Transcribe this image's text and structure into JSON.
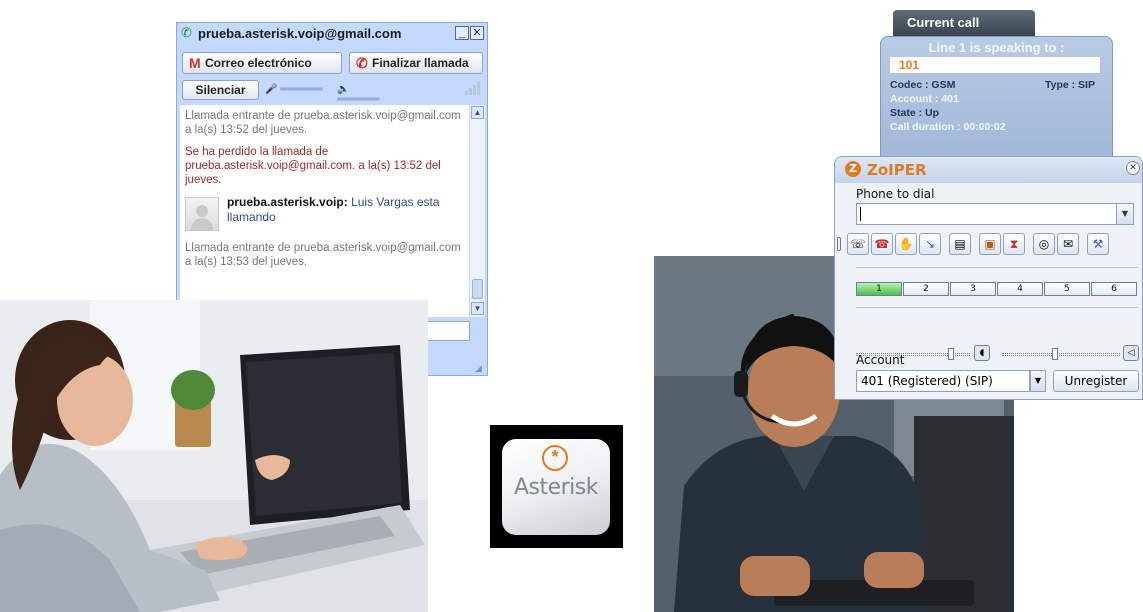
{
  "gmail_chat": {
    "title": "prueba.asterisk.voip@gmail.com",
    "minimize_glyph": "_",
    "close_glyph": "✕",
    "email_button": "Correo electrónico",
    "hangup_button": "Finalizar llamada",
    "mute_button": "Silenciar",
    "messages": [
      {
        "text": "Llamada entrante de prueba.asterisk.voip@gmail.com a la(s) 13:52 del jueves."
      },
      {
        "text": "Se ha perdido la llamada de prueba.asterisk.voip@gmail.com. a la(s) 13:52 del jueves."
      },
      {
        "text": "Llamada entrante de prueba.asterisk.voip@gmail.com a la(s) 13:53 del jueves."
      }
    ],
    "caller": {
      "name": "prueba.asterisk.voip:",
      "text": "Luis Vargas esta llamando"
    },
    "icons": {
      "phone": "phone-icon",
      "gmail": "gmail-icon",
      "mic": "microphone-icon",
      "speaker": "speaker-icon",
      "signal": "signal-icon"
    }
  },
  "asterisk_logo": {
    "word": "Asterisk",
    "mark": "*"
  },
  "current_call": {
    "tab": "Current call",
    "heading": "Line 1 is speaking to :",
    "number": "101",
    "codec": "Codec : GSM",
    "type": "Type : SIP",
    "account": "Account : 401",
    "state": "State : Up",
    "duration": "Call duration : 00:00:02"
  },
  "zoiper": {
    "brand": "ZoIPER",
    "phone_label": "Phone to dial",
    "dial_value": "",
    "line_buttons": [
      "1",
      "2",
      "3",
      "4",
      "5",
      "6"
    ],
    "active_line": "1",
    "account_label": "Account",
    "account_value": "401 (Registered) (SIP)",
    "unregister_button": "Unregister",
    "volume_level": 0.85,
    "speaker_level": 0.45,
    "accent": "#e07b22"
  }
}
